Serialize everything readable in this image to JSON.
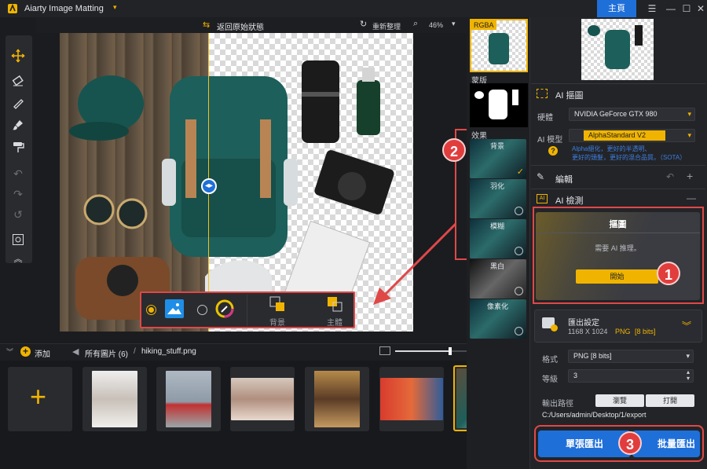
{
  "app": {
    "title": "Aiarty Image Matting",
    "home_label": "主頁"
  },
  "canvas_bar": {
    "restore_label": "返回原始狀態",
    "reset_label": "重新整理",
    "zoom": "46%"
  },
  "bg_toolbar": {
    "background_label": "背景",
    "subject_label": "主體"
  },
  "file_bar": {
    "add_label": "添加",
    "all_images": "所有圖片 (6)",
    "separator": "/",
    "filename": "hiking_stuff.png"
  },
  "fx_column": {
    "rgba_label": "RGBA",
    "mask_label": "蒙版",
    "effects_label": "效果",
    "effects": [
      {
        "label": "背景",
        "checked": true
      },
      {
        "label": "羽化",
        "checked": false
      },
      {
        "label": "模糊",
        "checked": false
      },
      {
        "label": "黑白",
        "checked": false
      },
      {
        "label": "像素化",
        "checked": false
      }
    ]
  },
  "right_panel": {
    "ai_matting": {
      "title": "AI 摳圖",
      "hardware_label": "硬體",
      "hardware_value": "NVIDIA GeForce GTX 980",
      "model_label": "AI 模型",
      "model_value": "AlphaStandard  V2",
      "model_desc_1": "Alpha絕化，更好的半透明、",
      "model_desc_2": "更好的頭髮，更好的混合品質。（SOTA）"
    },
    "edit": {
      "title": "編輯"
    },
    "ai_detect": {
      "title": "AI 檢測"
    },
    "matting_popup": {
      "title": "摳圖",
      "message": "需要 AI 推理。",
      "start_label": "開始"
    },
    "export_settings": {
      "title": "匯出設定",
      "size": "1168 X 1024",
      "format": "PNG",
      "bits": "[8 bits]",
      "format_label": "格式",
      "format_value": "PNG  [8 bits]",
      "level_label": "等級",
      "level_value": "3",
      "path_label": "輸出路徑",
      "browse_label": "瀏覽",
      "open_label": "打開",
      "path_value": "C:/Users/admin/Desktop/1/export"
    },
    "single_export_label": "單張匯出",
    "batch_export_label": "批量匯出"
  },
  "annotations": {
    "step1": "1",
    "step2": "2",
    "step3": "3"
  },
  "colors": {
    "accent_blue": "#1f6fd9",
    "accent_yellow": "#f0b400",
    "annotation_red": "#e13d3d"
  }
}
